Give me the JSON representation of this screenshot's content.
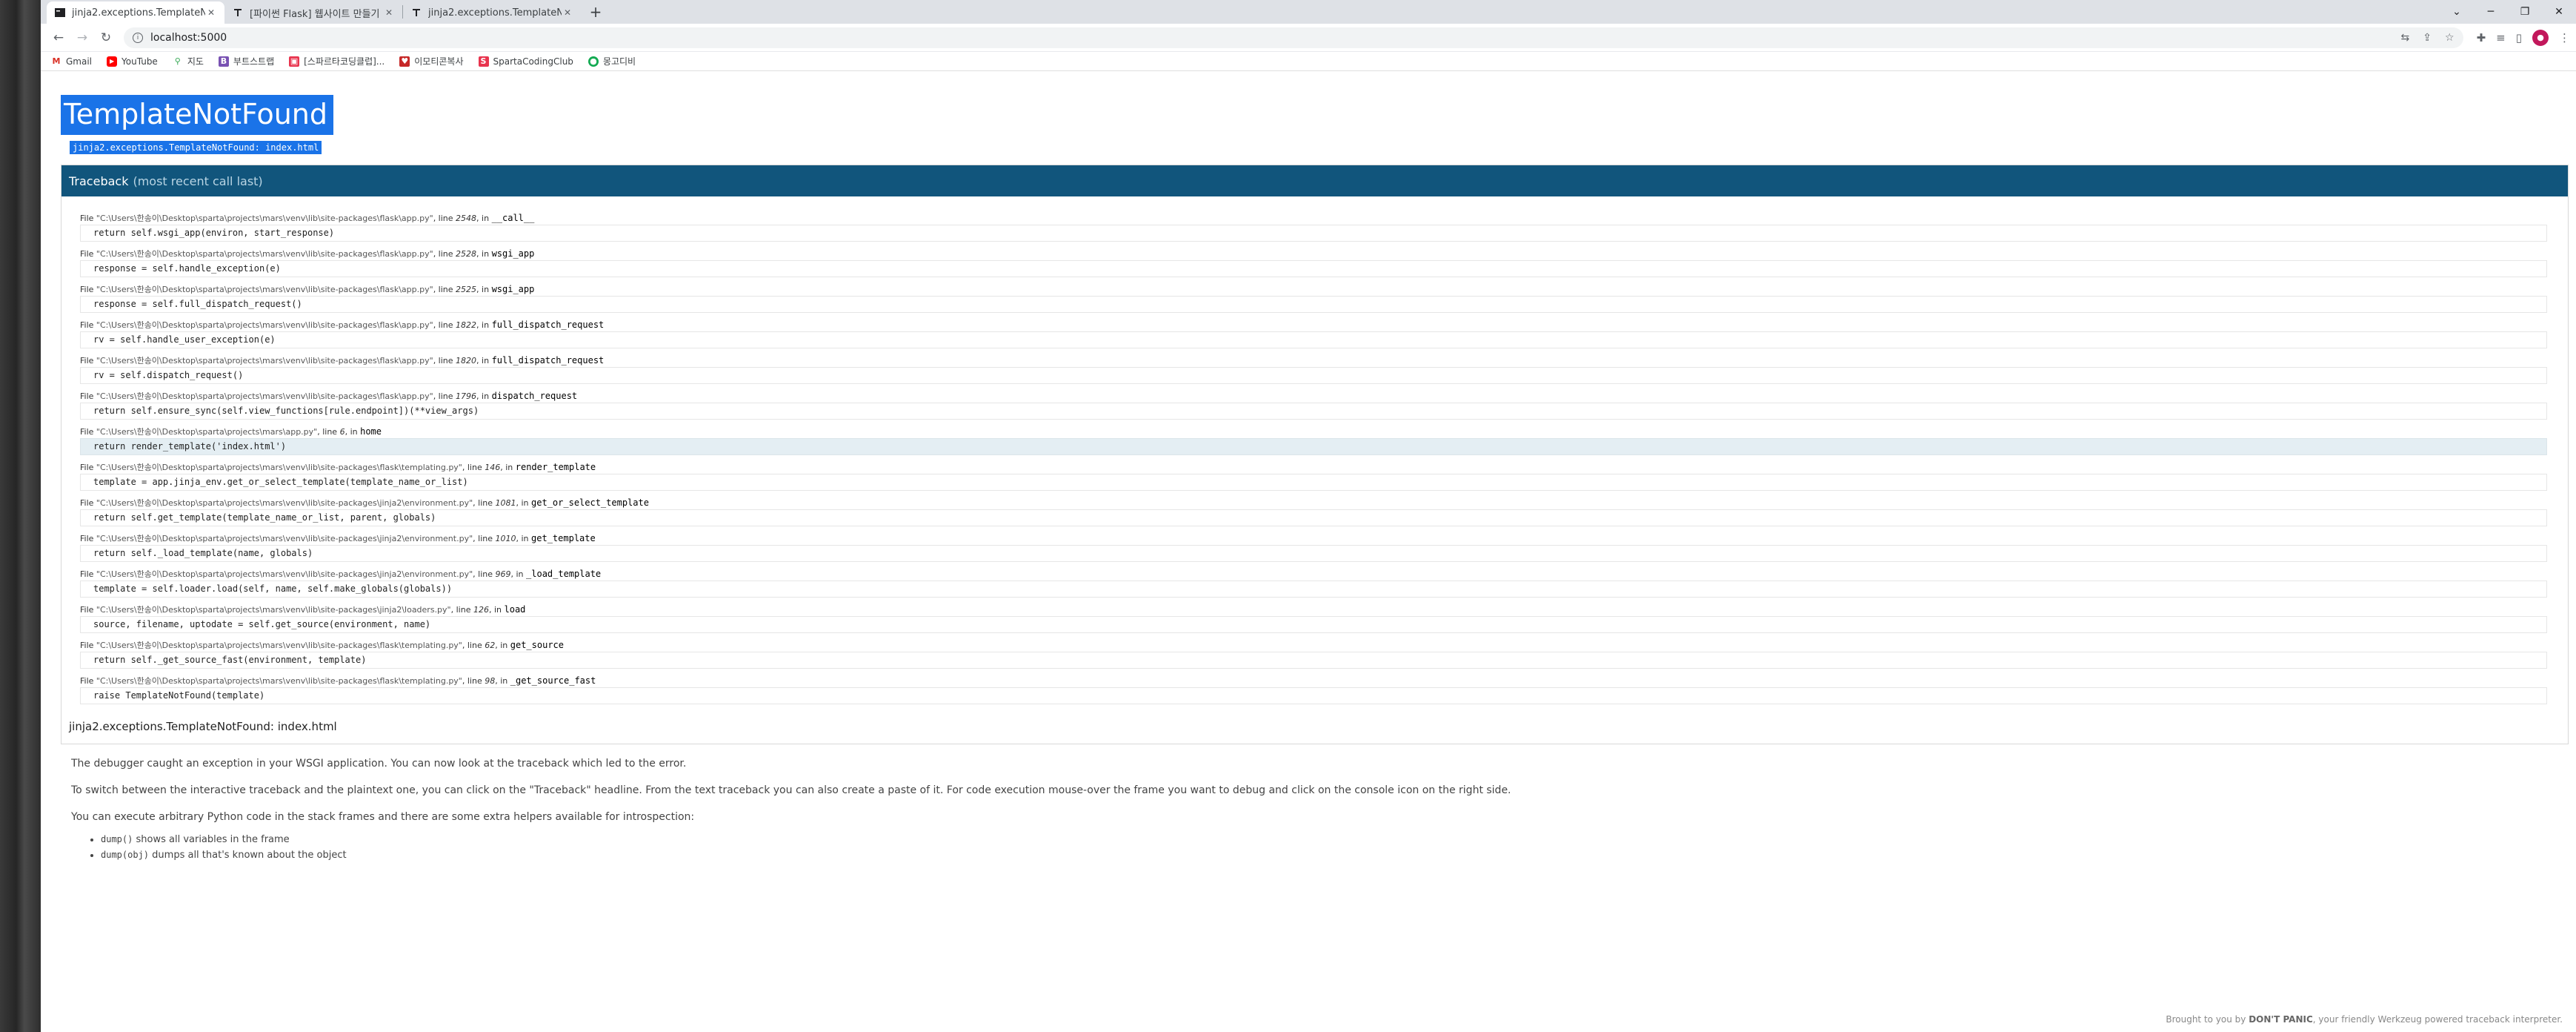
{
  "browser": {
    "tabs": [
      {
        "title": "jinja2.exceptions.TemplateNotFo",
        "favicon": "terminal-icon",
        "active": true
      },
      {
        "title": "[파이썬 Flask] 웹사이트 만들기",
        "favicon": "t-icon",
        "active": false
      },
      {
        "title": "jinja2.exceptions.TemplateNotFo",
        "favicon": "t-icon",
        "active": false
      }
    ],
    "new_tab": "+",
    "url": "localhost:5000",
    "bookmarks": [
      {
        "label": "Gmail",
        "icon": "gmail-icon",
        "color": "#d93025"
      },
      {
        "label": "YouTube",
        "icon": "youtube-icon",
        "color": "#ff0000"
      },
      {
        "label": "지도",
        "icon": "maps-icon",
        "color": "#34a853"
      },
      {
        "label": "부트스트랩",
        "icon": "bootstrap-icon",
        "color": "#7952b3"
      },
      {
        "label": "[스파르타코딩클럽]...",
        "icon": "sparta-icon",
        "color": "#e8344e"
      },
      {
        "label": "이모티콘복사",
        "icon": "emoji-icon",
        "color": "#c62828"
      },
      {
        "label": "SpartaCodingClub",
        "icon": "sparta-club-icon",
        "color": "#e8344e"
      },
      {
        "label": "몽고디비",
        "icon": "mongodb-icon",
        "color": "#13aa52"
      }
    ]
  },
  "error": {
    "title": "TemplateNotFound",
    "subtitle": "jinja2.exceptions.TemplateNotFound: index.html"
  },
  "traceback": {
    "header": "Traceback",
    "header_muted": "(most recent call last)",
    "frames": [
      {
        "file": "\"C:\\Users\\한송이\\Desktop\\sparta\\projects\\mars\\venv\\lib\\site-packages\\flask\\app.py\"",
        "line": "2548",
        "func": "__call__",
        "code": "return self.wsgi_app(environ, start_response)",
        "current": false
      },
      {
        "file": "\"C:\\Users\\한송이\\Desktop\\sparta\\projects\\mars\\venv\\lib\\site-packages\\flask\\app.py\"",
        "line": "2528",
        "func": "wsgi_app",
        "code": "response = self.handle_exception(e)",
        "current": false
      },
      {
        "file": "\"C:\\Users\\한송이\\Desktop\\sparta\\projects\\mars\\venv\\lib\\site-packages\\flask\\app.py\"",
        "line": "2525",
        "func": "wsgi_app",
        "code": "response = self.full_dispatch_request()",
        "current": false
      },
      {
        "file": "\"C:\\Users\\한송이\\Desktop\\sparta\\projects\\mars\\venv\\lib\\site-packages\\flask\\app.py\"",
        "line": "1822",
        "func": "full_dispatch_request",
        "code": "rv = self.handle_user_exception(e)",
        "current": false
      },
      {
        "file": "\"C:\\Users\\한송이\\Desktop\\sparta\\projects\\mars\\venv\\lib\\site-packages\\flask\\app.py\"",
        "line": "1820",
        "func": "full_dispatch_request",
        "code": "rv = self.dispatch_request()",
        "current": false
      },
      {
        "file": "\"C:\\Users\\한송이\\Desktop\\sparta\\projects\\mars\\venv\\lib\\site-packages\\flask\\app.py\"",
        "line": "1796",
        "func": "dispatch_request",
        "code": "return self.ensure_sync(self.view_functions[rule.endpoint])(**view_args)",
        "current": false
      },
      {
        "file": "\"C:\\Users\\한송이\\Desktop\\sparta\\projects\\mars\\app.py\"",
        "line": "6",
        "func": "home",
        "code": "return render_template('index.html')",
        "current": true
      },
      {
        "file": "\"C:\\Users\\한송이\\Desktop\\sparta\\projects\\mars\\venv\\lib\\site-packages\\flask\\templating.py\"",
        "line": "146",
        "func": "render_template",
        "code": "template = app.jinja_env.get_or_select_template(template_name_or_list)",
        "current": false
      },
      {
        "file": "\"C:\\Users\\한송이\\Desktop\\sparta\\projects\\mars\\venv\\lib\\site-packages\\jinja2\\environment.py\"",
        "line": "1081",
        "func": "get_or_select_template",
        "code": "return self.get_template(template_name_or_list, parent, globals)",
        "current": false
      },
      {
        "file": "\"C:\\Users\\한송이\\Desktop\\sparta\\projects\\mars\\venv\\lib\\site-packages\\jinja2\\environment.py\"",
        "line": "1010",
        "func": "get_template",
        "code": "return self._load_template(name, globals)",
        "current": false
      },
      {
        "file": "\"C:\\Users\\한송이\\Desktop\\sparta\\projects\\mars\\venv\\lib\\site-packages\\jinja2\\environment.py\"",
        "line": "969",
        "func": "_load_template",
        "code": "template = self.loader.load(self, name, self.make_globals(globals))",
        "current": false
      },
      {
        "file": "\"C:\\Users\\한송이\\Desktop\\sparta\\projects\\mars\\venv\\lib\\site-packages\\jinja2\\loaders.py\"",
        "line": "126",
        "func": "load",
        "code": "source, filename, uptodate = self.get_source(environment, name)",
        "current": false
      },
      {
        "file": "\"C:\\Users\\한송이\\Desktop\\sparta\\projects\\mars\\venv\\lib\\site-packages\\flask\\templating.py\"",
        "line": "62",
        "func": "get_source",
        "code": "return self._get_source_fast(environment, template)",
        "current": false
      },
      {
        "file": "\"C:\\Users\\한송이\\Desktop\\sparta\\projects\\mars\\venv\\lib\\site-packages\\flask\\templating.py\"",
        "line": "98",
        "func": "_get_source_fast",
        "code": "raise TemplateNotFound(template)",
        "current": false
      }
    ],
    "final_error": "jinja2.exceptions.TemplateNotFound: index.html"
  },
  "explanation": {
    "p1": "The debugger caught an exception in your WSGI application. You can now look at the traceback which led to the error.",
    "p2": "To switch between the interactive traceback and the plaintext one, you can click on the \"Traceback\" headline. From the text traceback you can also create a paste of it. For code execution mouse-over the frame you want to debug and click on the console icon on the right side.",
    "p3": "You can execute arbitrary Python code in the stack frames and there are some extra helpers available for introspection:",
    "helpers": [
      {
        "code": "dump()",
        "text": " shows all variables in the frame"
      },
      {
        "code": "dump(obj)",
        "text": " dumps all that's known about the object"
      }
    ]
  },
  "footer": {
    "prefix": "Brought to you by ",
    "brand": "DON'T PANIC",
    "suffix": ", your friendly Werkzeug powered traceback interpreter."
  },
  "colors": {
    "header_bg": "#11557c",
    "selection": "#1a73e8",
    "current_frame": "#e4eef3"
  }
}
